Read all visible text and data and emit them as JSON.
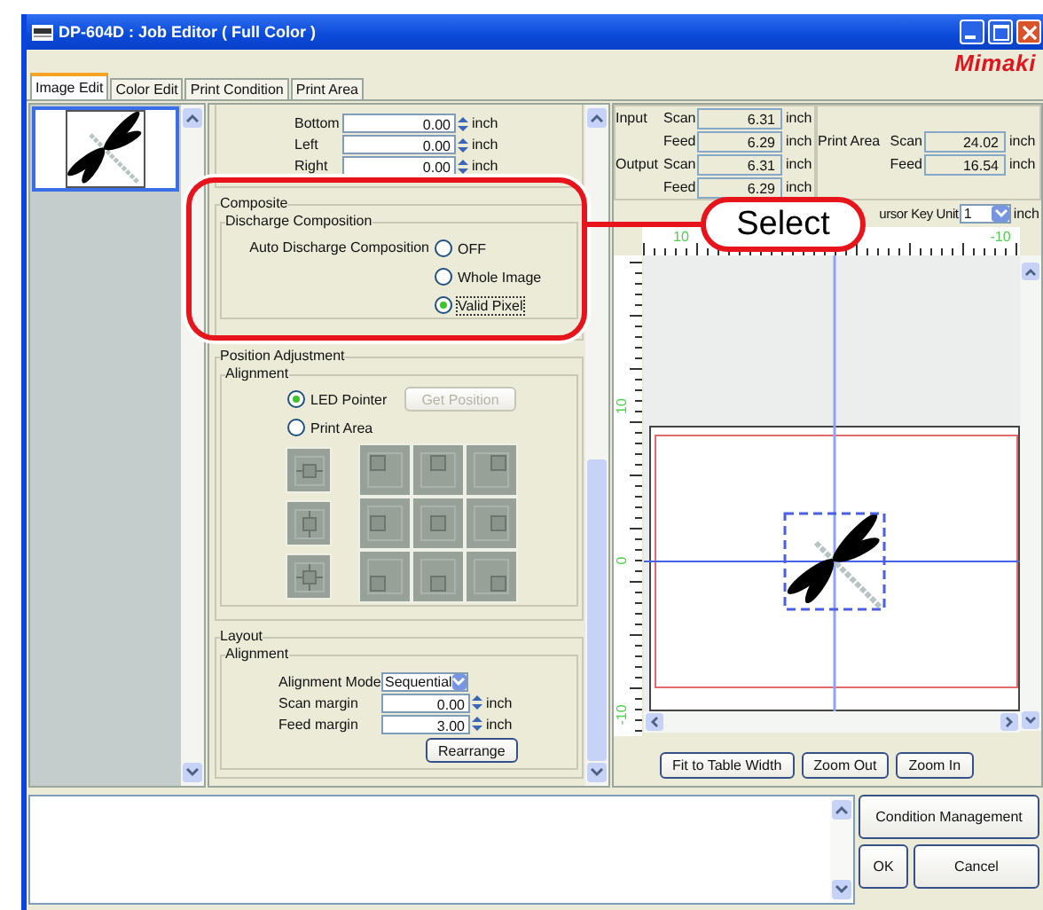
{
  "window": {
    "title": "DP-604D : Job Editor ( Full Color )"
  },
  "logo": "Mimaki",
  "tabs": [
    {
      "label": "Image Edit",
      "selected": true
    },
    {
      "label": "Color Edit",
      "selected": false
    },
    {
      "label": "Print Condition",
      "selected": false
    },
    {
      "label": "Print Area",
      "selected": false
    }
  ],
  "margins": [
    {
      "label": "Bottom",
      "value": "0.00",
      "unit": "inch"
    },
    {
      "label": "Left",
      "value": "0.00",
      "unit": "inch"
    },
    {
      "label": "Right",
      "value": "0.00",
      "unit": "inch"
    }
  ],
  "composite": {
    "title": "Composite",
    "group": "Discharge Composition",
    "label": "Auto Discharge Composition",
    "options": [
      {
        "label": "OFF",
        "selected": false
      },
      {
        "label": "Whole Image",
        "selected": false
      },
      {
        "label": "Valid Pixel",
        "selected": true
      }
    ]
  },
  "position_adjustment": {
    "title": "Position Adjustment",
    "group": "Alignment",
    "options": [
      {
        "label": "LED Pointer",
        "selected": true
      },
      {
        "label": "Print Area",
        "selected": false
      }
    ],
    "get_position": {
      "label": "Get Position",
      "disabled": true
    }
  },
  "layout": {
    "title": "Layout",
    "group": "Alignment",
    "mode_label": "Alignment Mode",
    "mode": "Sequential",
    "fields": [
      {
        "label": "Scan margin",
        "value": "0.00",
        "unit": "inch"
      },
      {
        "label": "Feed margin",
        "value": "3.00",
        "unit": "inch"
      }
    ],
    "button": "Rearrange"
  },
  "info": {
    "rows": [
      {
        "group": "Input",
        "axis": "Scan",
        "value": "6.31",
        "unit": "inch"
      },
      {
        "axis": "Feed",
        "value": "6.29",
        "unit": "inch"
      },
      {
        "group": "Output",
        "axis": "Scan",
        "value": "6.31",
        "unit": "inch"
      },
      {
        "axis": "Feed",
        "value": "6.29",
        "unit": "inch"
      }
    ]
  },
  "print_area": {
    "label": "Print Area",
    "rows": [
      {
        "axis": "Scan",
        "value": "24.02",
        "unit": "inch"
      },
      {
        "axis": "Feed",
        "value": "16.54",
        "unit": "inch"
      }
    ]
  },
  "cursor_key_unit": {
    "label": "ursor Key Unit",
    "value": "1",
    "unit": "inch"
  },
  "ruler": {
    "top_labels": [
      "10",
      "-10"
    ],
    "left_labels": [
      "10",
      "0",
      "-10"
    ]
  },
  "view_buttons": [
    "Fit to Table Width",
    "Zoom Out",
    "Zoom In"
  ],
  "bottom_buttons": [
    "Condition Management",
    "OK",
    "Cancel"
  ],
  "callout": {
    "label": "Select"
  }
}
